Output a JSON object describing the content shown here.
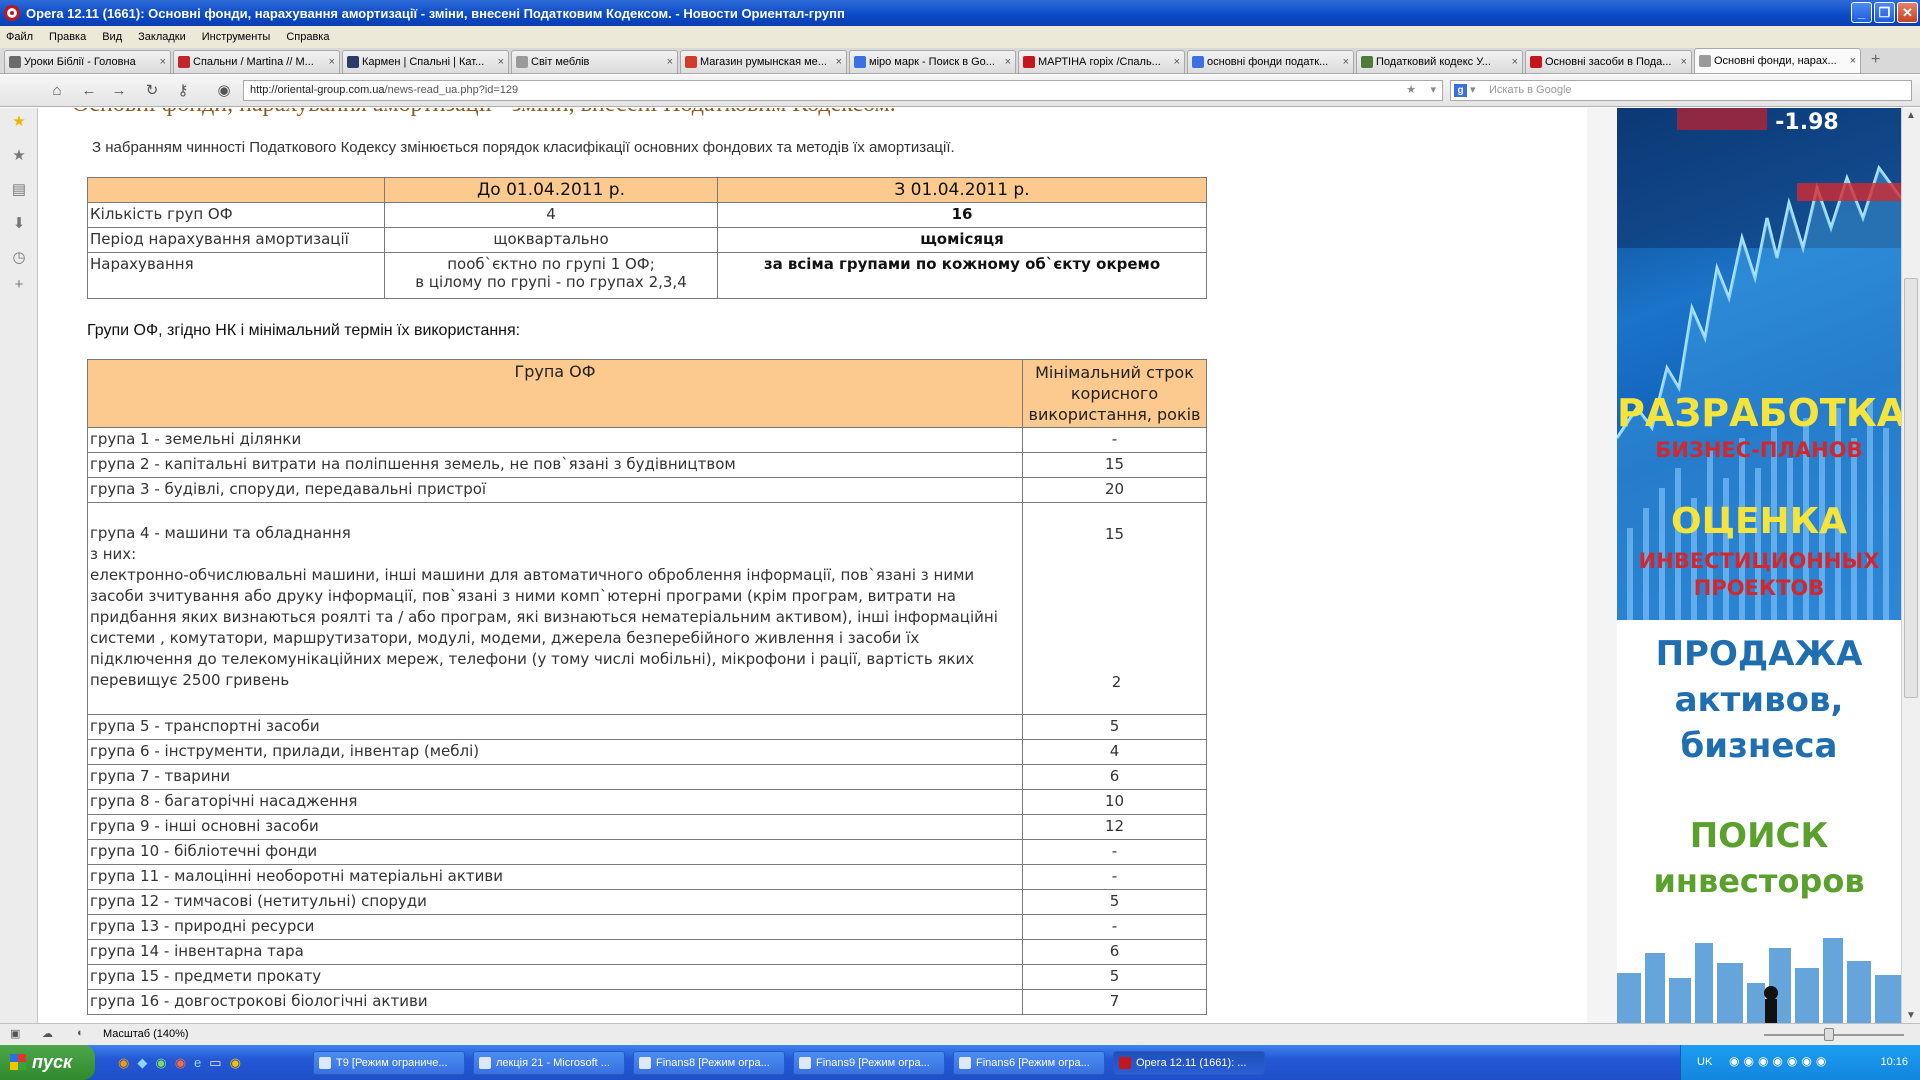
{
  "window": {
    "title": "Opera 12.11 (1661): Основні фонди, нарахування амортизації - зміни, внесені Податковим Кодексом. - Новости Ориентал-групп"
  },
  "menu": [
    "Файл",
    "Правка",
    "Вид",
    "Закладки",
    "Инструменты",
    "Справка"
  ],
  "tabs": [
    {
      "title": "Уроки Біблії - Головна",
      "icon_color": "#6b6b6b"
    },
    {
      "title": "Спальни / Martina // M...",
      "icon_color": "#c0262e"
    },
    {
      "title": "Кармен | Спальні | Кат...",
      "icon_color": "#2b3a68"
    },
    {
      "title": "Світ меблів",
      "icon_color": "#9a9a9a"
    },
    {
      "title": "Магазин румынская ме...",
      "icon_color": "#d13b2a"
    },
    {
      "title": "міро марк - Поиск в Go...",
      "icon_color": "#3a70e0"
    },
    {
      "title": "МАРТІНА горіх /Спаль...",
      "icon_color": "#c4161c"
    },
    {
      "title": "основні фонди податк...",
      "icon_color": "#3a70e0"
    },
    {
      "title": "Податковий кодекс У...",
      "icon_color": "#4f7a37"
    },
    {
      "title": "Основні засоби в Пода...",
      "icon_color": "#c4161c"
    },
    {
      "title": "Основні фонди, нарах...",
      "icon_color": "#9a9a9a"
    }
  ],
  "address": {
    "host": "http://oriental-group.com.ua",
    "path": "/news-read_ua.php?id=129",
    "search_placeholder": "Искать в Google"
  },
  "page": {
    "heading": "Основні фонди, нарахування амортизації - зміни, внесені Податковим Кодексом.",
    "intro": "З набранням чинності Податкового Кодексу змінюється порядок класифікації основних фондових та методів їх амортизації.",
    "table1": {
      "headers": [
        "",
        "До 01.04.2011 р.",
        "З 01.04.2011 р."
      ],
      "rows": [
        {
          "label": "Кількість груп ОФ",
          "before": "4",
          "after": "16"
        },
        {
          "label": "Період нарахування амортизації",
          "before": "щоквартально",
          "after": "щомісяця"
        },
        {
          "label": "Нарахування",
          "before": "пооб`єктно по групі 1 ОФ;",
          "before2": "в цілому по групі - по групах 2,3,4",
          "after": "за всіма групами по кожному об`єкту окремо"
        }
      ]
    },
    "subheading": "Групи ОФ, згідно НК і мінімальний термін їх використання:",
    "table2": {
      "header_group": "Група ОФ",
      "header_term_line1": "Мінімальний строк",
      "header_term_line2": "корисного",
      "header_term_line3": "використання, років",
      "rows": [
        {
          "group": "група 1 - земельні ділянки",
          "term": "-"
        },
        {
          "group": "група 2 - капітальні витрати на поліпшення земель, не пов`язані з будівництвом",
          "term": "15"
        },
        {
          "group": "група 3 - будівлі, споруди, передавальні пристрої",
          "term": "20"
        }
      ],
      "group4": {
        "title": "група 4 - машини та обладнання",
        "of_them": "з них:",
        "detail": "електронно-обчислювальні машини, інші машини для автоматичного оброблення інформації, пов`язані з ними засоби зчитування або друку інформації, пов`язані з ними комп`ютерні програми (крім програм, витрати на придбання яких визнаються роялті та / або програм, які визнаються нематеріальним активом), інші інформаційні системи , комутатори, маршрутизатори, модулі, модеми, джерела безперебійного живлення і засоби їх підключення до телекомунікаційних мереж, телефони (у тому числі мобільні), мікрофони і рації, вартість яких перевищує 2500 гривень",
        "term": "15",
        "detail_term": "2"
      },
      "rows_after": [
        {
          "group": "група 5 - транспортні засоби",
          "term": "5"
        },
        {
          "group": "група 6 - інструменти, прилади, інвентар (меблі)",
          "term": "4"
        },
        {
          "group": "група 7 - тварини",
          "term": "6"
        },
        {
          "group": "група 8 - багаторічні насадження",
          "term": "10"
        },
        {
          "group": "група 9 - інші основні засоби",
          "term": "12"
        },
        {
          "group": "група 10 - бібліотечні фонди",
          "term": "-"
        },
        {
          "group": "група 11 - малоцінні необоротні матеріальні активи",
          "term": "-"
        },
        {
          "group": "група 12 - тимчасові (нетитульні) споруди",
          "term": "5"
        },
        {
          "group": "група 13 - природні ресурси",
          "term": "-"
        },
        {
          "group": "група 14 - інвентарна тара",
          "term": "6"
        },
        {
          "group": "група 15 - предмети прокату",
          "term": "5"
        },
        {
          "group": "група 16 - довгострокові біологічні активи",
          "term": "7"
        }
      ]
    }
  },
  "ad": {
    "ticker": "-1.98",
    "l1": "РАЗРАБОТКА",
    "l2": "БИЗНЕС-ПЛАНОВ",
    "l3": "ОЦЕНКА",
    "l4": "ИНВЕСТИЦИОННЫХ",
    "l5": "ПРОЕКТОВ",
    "l6": "ПРОДАЖА",
    "l7": "активов,",
    "l8": "бизнеса",
    "l9": "ПОИСК",
    "l10": "инвесторов",
    "colors": {
      "blue": "#1f6fb0",
      "green": "#5aa02c",
      "red": "#b3261e",
      "yellow": "#f4e43b"
    }
  },
  "status": {
    "zoom": "Масштаб (140%)"
  },
  "taskbar": {
    "start": "пуск",
    "tasks": [
      "T9 [Режим ограниче...",
      "лекція 21 - Microsoft ...",
      "Finans8 [Режим огра...",
      "Finans9 [Режим огра...",
      "Finans6 [Режим огра...",
      "Opera 12.11 (1661): ..."
    ],
    "lang": "UK",
    "clock": "10:16"
  }
}
